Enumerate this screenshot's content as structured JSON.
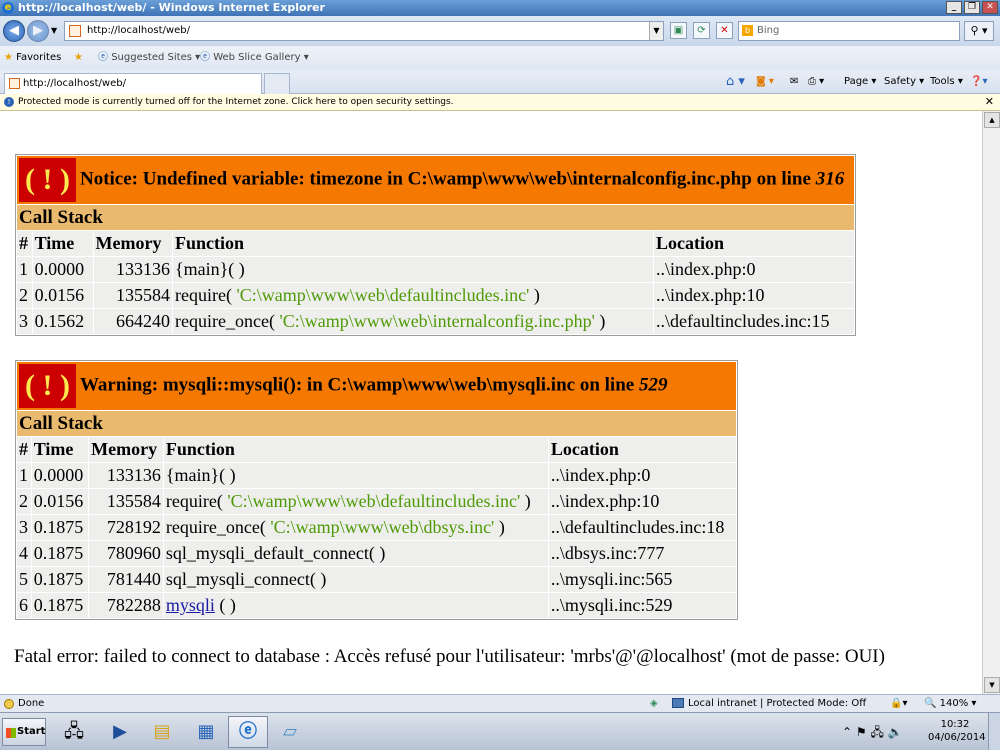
{
  "window": {
    "title": "http://localhost/web/ - Windows Internet Explorer",
    "controls": [
      "_",
      "❐",
      "✕"
    ]
  },
  "address_bar": {
    "url": "http://localhost/web/",
    "search_placeholder": "Bing"
  },
  "favorites_bar": {
    "favorites_label": "Favorites",
    "items": [
      "Suggested Sites ▾",
      "Web Slice Gallery ▾"
    ]
  },
  "tab": {
    "label": "http://localhost/web/"
  },
  "command_bar": {
    "items": [
      "Page ▾",
      "Safety ▾",
      "Tools ▾"
    ]
  },
  "info_bar": {
    "text": "Protected mode is currently turned off for the Internet zone.  Click here to open security settings."
  },
  "errors": [
    {
      "heading_label": "Notice: Undefined variable: timezone in C:\\wamp\\www\\web\\internalconfig.inc.php on line ",
      "line": "316",
      "call_stack_label": "Call Stack",
      "columns": [
        "#",
        "Time",
        "Memory",
        "Function",
        "Location"
      ],
      "rows": [
        {
          "num": "1",
          "time": "0.0000",
          "memory": "133136",
          "fn": "{main}( )",
          "arg": "",
          "fn_end": "",
          "location": "..\\index.php:0"
        },
        {
          "num": "2",
          "time": "0.0156",
          "memory": "135584",
          "fn": "require( ",
          "arg": "'C:\\wamp\\www\\web\\defaultincludes.inc'",
          "fn_end": " )",
          "location": "..\\index.php:10"
        },
        {
          "num": "3",
          "time": "0.1562",
          "memory": "664240",
          "fn": "require_once( ",
          "arg": "'C:\\wamp\\www\\web\\internalconfig.inc.php'",
          "fn_end": " )",
          "location": "..\\defaultincludes.inc:15"
        }
      ]
    },
    {
      "heading_label": "Warning: mysqli::mysqli(): in C:\\wamp\\www\\web\\mysqli.inc on line ",
      "line": "529",
      "call_stack_label": "Call Stack",
      "columns": [
        "#",
        "Time",
        "Memory",
        "Function",
        "Location"
      ],
      "rows": [
        {
          "num": "1",
          "time": "0.0000",
          "memory": "133136",
          "fn": "{main}( )",
          "arg": "",
          "fn_end": "",
          "location": "..\\index.php:0"
        },
        {
          "num": "2",
          "time": "0.0156",
          "memory": "135584",
          "fn": "require( ",
          "arg": "'C:\\wamp\\www\\web\\defaultincludes.inc'",
          "fn_end": " )",
          "location": "..\\index.php:10"
        },
        {
          "num": "3",
          "time": "0.1875",
          "memory": "728192",
          "fn": "require_once( ",
          "arg": "'C:\\wamp\\www\\web\\dbsys.inc'",
          "fn_end": " )",
          "location": "..\\defaultincludes.inc:18"
        },
        {
          "num": "4",
          "time": "0.1875",
          "memory": "780960",
          "fn": "sql_mysqli_default_connect( )",
          "arg": "",
          "fn_end": "",
          "location": "..\\dbsys.inc:777"
        },
        {
          "num": "5",
          "time": "0.1875",
          "memory": "781440",
          "fn": "sql_mysqli_connect( )",
          "arg": "",
          "fn_end": "",
          "location": "..\\mysqli.inc:565"
        },
        {
          "num": "6",
          "time": "0.1875",
          "memory": "782288",
          "fn": "",
          "arg": "",
          "fn_end": "",
          "link": "mysqli",
          "after_link": " ( )",
          "location": "..\\mysqli.inc:529"
        }
      ]
    }
  ],
  "fatal_error": "Fatal error: failed to connect to database : Accès refusé pour l'utilisateur: 'mrbs'@'@localhost' (mot de passe: OUI)",
  "status_bar": {
    "status": "Done",
    "zone": "Local intranet | Protected Mode: Off",
    "zoom": "🔍 140% ▾"
  },
  "taskbar": {
    "start_label": "Start",
    "clock_time": "10:32",
    "clock_date": "04/06/2014"
  },
  "icons": {
    "back": "back-arrow-icon",
    "forward": "forward-arrow-icon",
    "refresh": "refresh-icon",
    "stop": "stop-icon",
    "home": "home-icon",
    "rss": "feeds-icon",
    "print": "print-icon",
    "help": "help-icon"
  },
  "colors": {
    "error_header": "#f57900",
    "call_stack_header": "#e9b96e",
    "bang_background": "#cc0000",
    "string_argument": "#4e9a06"
  }
}
